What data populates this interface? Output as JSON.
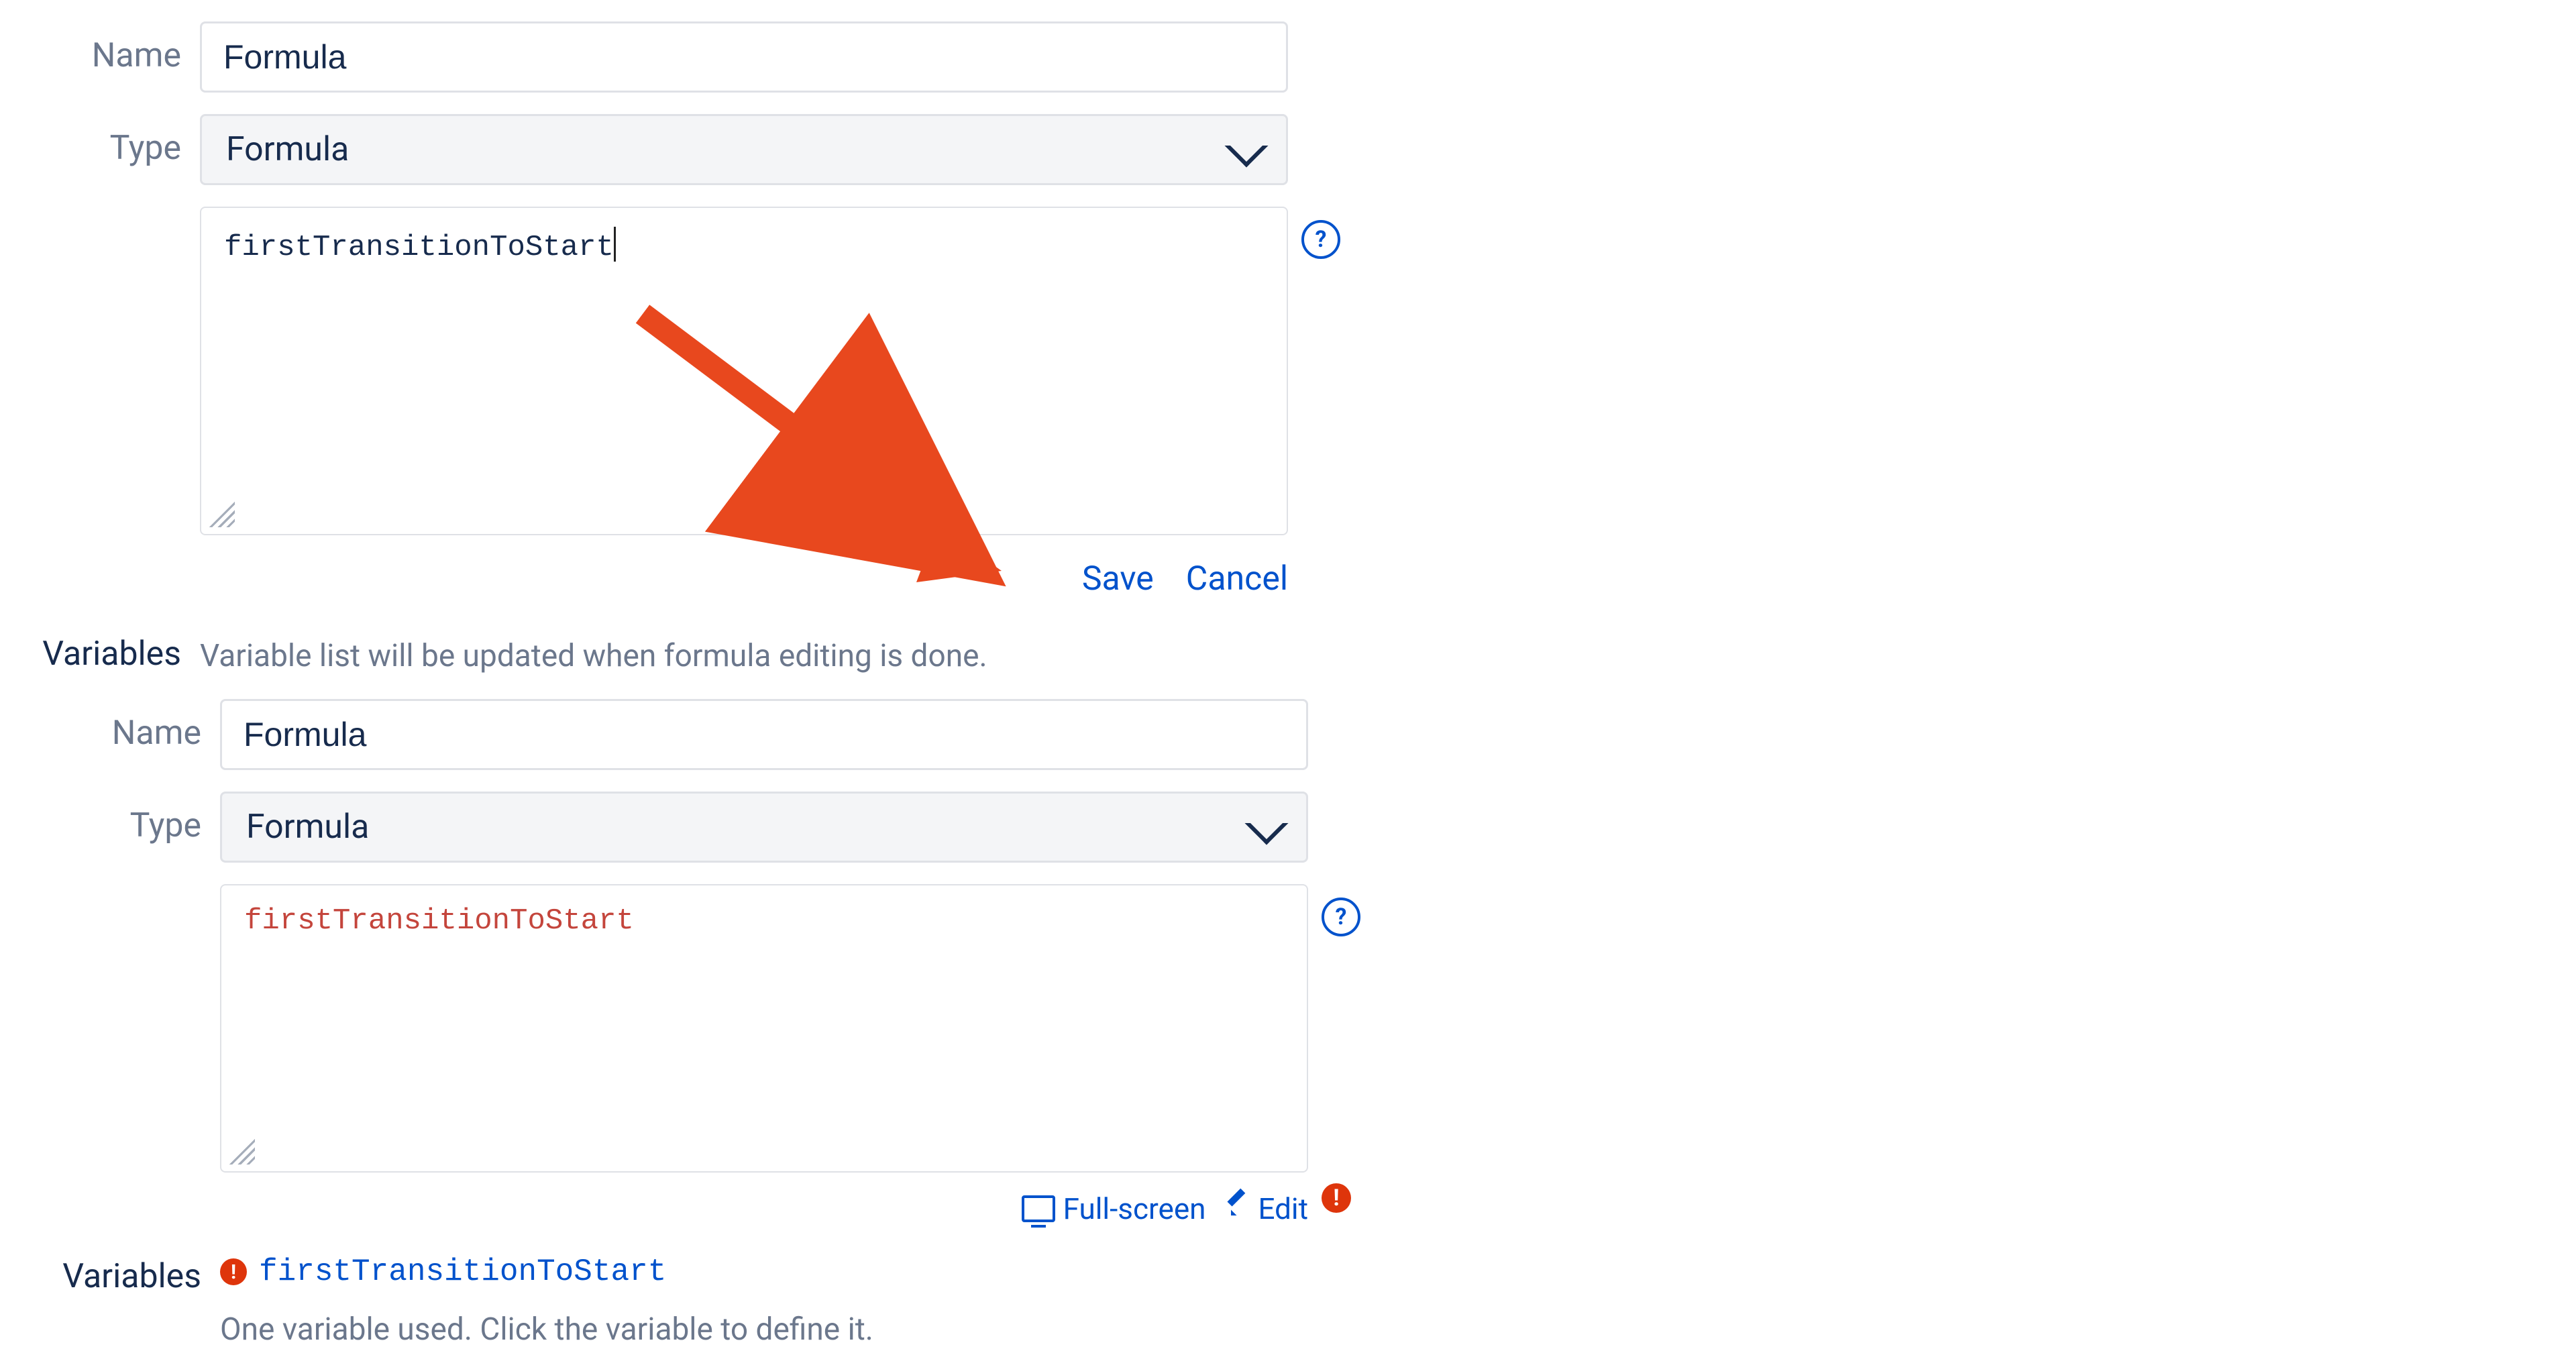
{
  "left": {
    "name": {
      "label": "Name",
      "value": "Formula"
    },
    "type": {
      "label": "Type",
      "value": "Formula"
    },
    "formula": {
      "text": "firstTransitionToStart"
    },
    "actions": {
      "save": "Save",
      "cancel": "Cancel"
    },
    "variables": {
      "label": "Variables",
      "hint": "Variable list will be updated when formula editing is done."
    }
  },
  "right": {
    "name": {
      "label": "Name",
      "value": "Formula"
    },
    "type": {
      "label": "Type",
      "value": "Formula"
    },
    "formula": {
      "text": "firstTransitionToStart"
    },
    "toolbar": {
      "fullscreen": "Full-screen",
      "edit": "Edit"
    },
    "variables": {
      "label": "Variables",
      "items": [
        "firstTransitionToStart"
      ],
      "hint": "One variable used. Click the variable to define it."
    }
  },
  "icons": {
    "help": "?",
    "error": "!"
  }
}
